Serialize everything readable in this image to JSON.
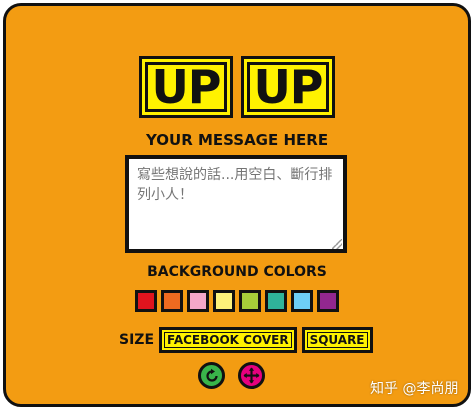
{
  "logo": {
    "tiles": [
      "UP",
      "UP"
    ]
  },
  "message": {
    "heading": "YOUR MESSAGE HERE",
    "placeholder": "寫些想說的話...用空白、斷行排列小人！"
  },
  "background": {
    "heading": "BACKGROUND COLORS",
    "swatches": [
      "#E0141E",
      "#EE6A20",
      "#F4A7C8",
      "#FDF27A",
      "#A6CE39",
      "#2FB39A",
      "#6ECFF6",
      "#92278F"
    ]
  },
  "size": {
    "label": "SIZE",
    "options": [
      "FACEBOOK COVER",
      "SQUARE"
    ]
  },
  "actions": [
    {
      "icon": "refresh-icon",
      "color": "#39B54A"
    },
    {
      "icon": "move-icon",
      "color": "#E6007E"
    }
  ],
  "watermark": "知乎 @李尚朋",
  "colors": {
    "card_bg": "#F39C12",
    "accent_yellow": "#FFF200",
    "outline": "#111111"
  }
}
